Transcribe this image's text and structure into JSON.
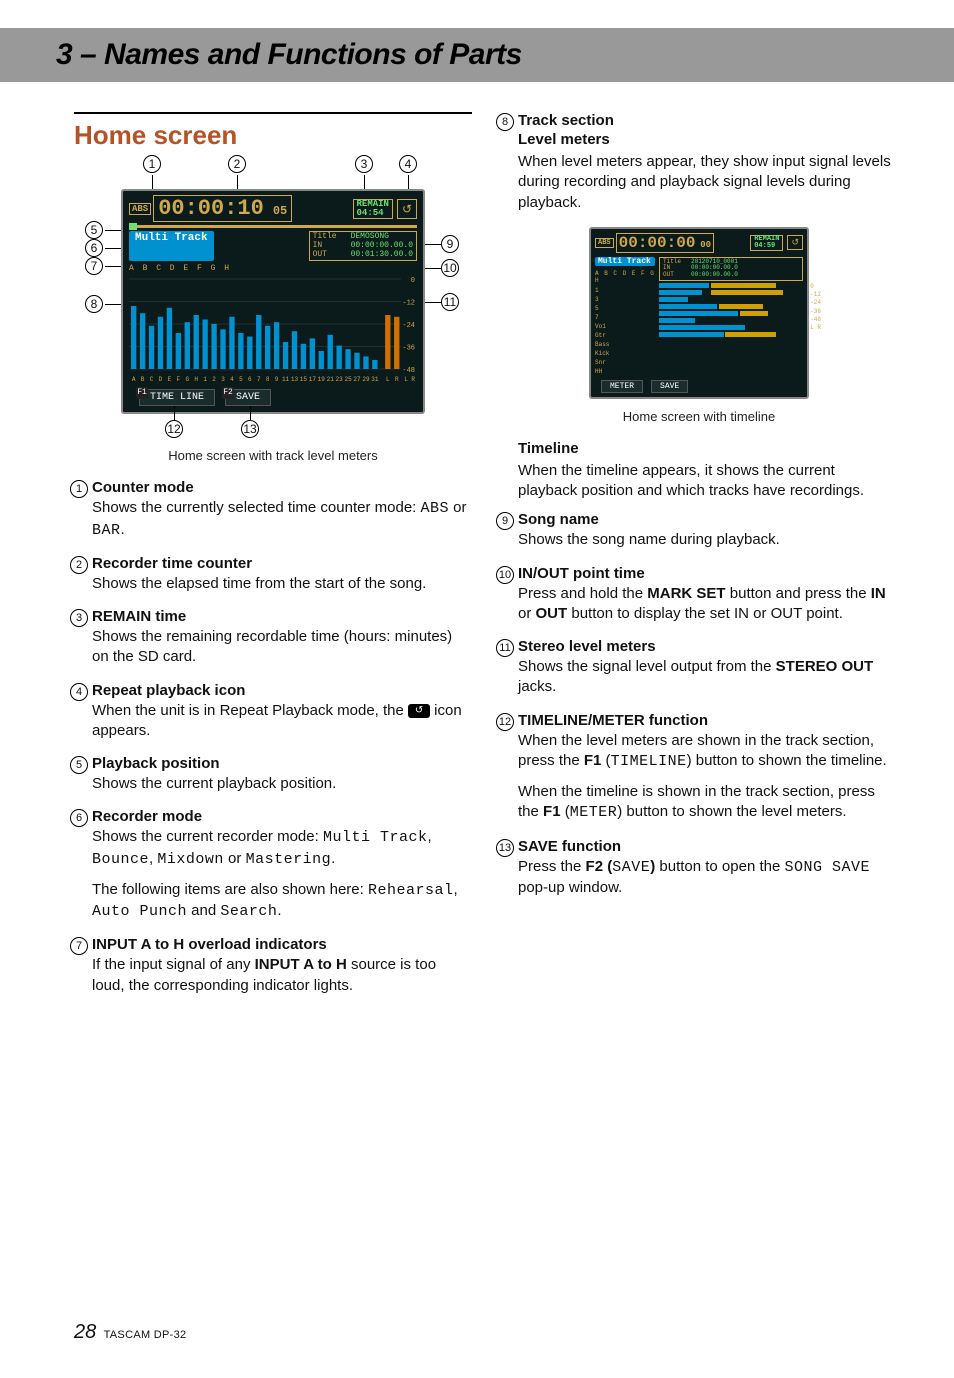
{
  "chapter_title": "3 – Names and Functions of Parts",
  "section_title": "Home screen",
  "fig1_caption": "Home screen with track level meters",
  "fig2_caption": "Home screen with timeline",
  "lcd1": {
    "abs": "ABS",
    "time_main": "00:00:10",
    "time_sub": "05",
    "remain_label": "REMAIN",
    "remain_value": "04:54",
    "multi_track": "Multi Track",
    "title_label": "Title",
    "title_value": "DEMOSONG",
    "in_label": "IN",
    "in_value": "00:00:00.00.0",
    "out_label": "OUT",
    "out_value": "00:01:30.00.0",
    "overload_letters": "A B C D E F G H",
    "f1_label": "TIME LINE",
    "f2_label": "SAVE"
  },
  "lcd2": {
    "abs": "ABS",
    "time_main": "00:00:00",
    "time_sub": "00",
    "remain_label": "REMAIN",
    "remain_value": "04:59",
    "multi_track": "Multi Track",
    "title_label": "Title",
    "title_value": "20120710_0001",
    "in_label": "IN",
    "in_value": "00:00:00.00.0",
    "out_label": "OUT",
    "out_value": "00:00:00.00.0",
    "overload_letters": "A B C D E F G H",
    "scale": [
      "0",
      "-12",
      "-24",
      "-36",
      "-48",
      "L R"
    ],
    "f1_label": "METER",
    "f2_label": "SAVE"
  },
  "callouts": [
    "1",
    "2",
    "3",
    "4",
    "5",
    "6",
    "7",
    "8",
    "9",
    "10",
    "11",
    "12",
    "13"
  ],
  "items_left": [
    {
      "n": "1",
      "title": "Counter mode",
      "body_html": "Shows the currently selected time counter mode: <span class='mono'>ABS</span> or <span class='mono'>BAR</span>."
    },
    {
      "n": "2",
      "title": "Recorder time counter",
      "body_html": "Shows the elapsed time from the start of the song."
    },
    {
      "n": "3",
      "title": "REMAIN time",
      "body_html": "Shows the remaining recordable time (hours: minutes) on the SD card."
    },
    {
      "n": "4",
      "title": "Repeat playback icon",
      "body_html": "When the unit is in Repeat Playback mode, the <span class='repeat-icon'>↺</span> icon appears."
    },
    {
      "n": "5",
      "title": "Playback position",
      "body_html": "Shows the current playback position."
    },
    {
      "n": "6",
      "title": "Recorder mode",
      "body_html": "Shows the current recorder mode: <span class='mono'>Multi Track</span>, <span class='mono'>Bounce</span>, <span class='mono'>Mixdown</span> or <span class='mono'>Mastering</span>.",
      "body_html2": "The following items are also shown here: <span class='mono'>Rehearsal</span>, <span class='mono'>Auto Punch</span> and <span class='mono'>Search</span>."
    },
    {
      "n": "7",
      "title": "INPUT A to H overload indicators",
      "body_html": "If the input signal of any <b>INPUT A to H</b> source is too loud, the corresponding indicator lights."
    }
  ],
  "items_right_top": {
    "n": "8",
    "title": "Track section",
    "subtitle1": "Level meters",
    "body1": "When level meters appear, they show input signal levels during recording and playback signal levels during playback.",
    "subtitle2": "Timeline",
    "body2": "When the timeline appears, it shows the current playback position and which tracks have recordings."
  },
  "items_right": [
    {
      "n": "9",
      "title": "Song name",
      "body_html": "Shows the song name during playback."
    },
    {
      "n": "10",
      "title": "IN/OUT point time",
      "body_html": "Press and hold the <b>MARK SET</b> button and press the <b>IN</b> or <b>OUT</b> button to display the set IN or OUT point."
    },
    {
      "n": "11",
      "title": "Stereo level meters",
      "body_html": "Shows the signal level output from the <b>STEREO OUT</b> jacks."
    },
    {
      "n": "12",
      "title": "TIMELINE/METER function",
      "body_html": "When the level meters are shown in the track section, press the <b>F1</b> (<span class='mono'>TIMELINE</span>) button to shown the timeline.",
      "body_html2": "When the timeline is shown in the track section, press the <b>F1</b> (<span class='mono'>METER</span>) button to shown the level meters."
    },
    {
      "n": "13",
      "title": "SAVE function",
      "body_html": "Press the <b>F2 (</b><span class='mono'>SAVE</span><b>)</b> button to open the <span class='mono'>SONG SAVE</span> pop-up window."
    }
  ],
  "footer": {
    "page": "28",
    "product": "TASCAM DP-32"
  },
  "chart_data": {
    "type": "bar",
    "note": "Approximate track level meter heights read from figure (arbitrary units 0–100).",
    "categories": [
      "A",
      "B",
      "C",
      "D",
      "E",
      "F",
      "G",
      "H",
      "1",
      "2",
      "3",
      "4",
      "5",
      "6",
      "7",
      "8",
      "9",
      "11",
      "13",
      "15",
      "17",
      "19",
      "21",
      "23",
      "25",
      "27",
      "29",
      "31",
      "L",
      "R"
    ],
    "values": [
      70,
      62,
      48,
      58,
      68,
      40,
      52,
      60,
      55,
      50,
      44,
      58,
      40,
      36,
      60,
      48,
      52,
      30,
      42,
      28,
      34,
      20,
      38,
      26,
      22,
      18,
      14,
      10,
      60,
      58
    ]
  }
}
